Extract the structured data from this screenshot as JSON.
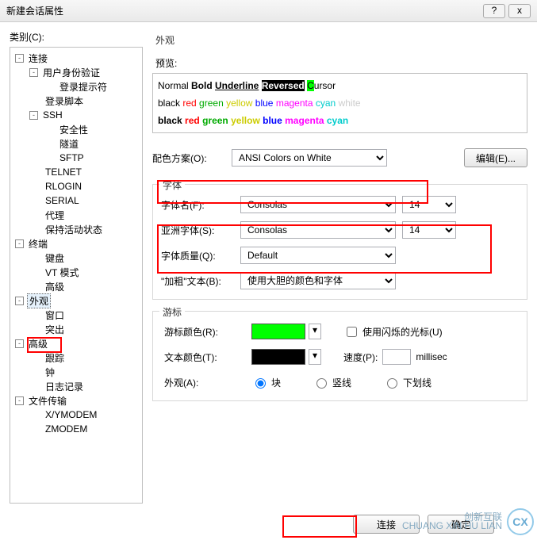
{
  "window": {
    "title": "新建会话属性",
    "help": "?",
    "close": "x"
  },
  "category": {
    "label": "类别(C):"
  },
  "tree": {
    "connection": "连接",
    "auth": "用户身份验证",
    "login_prompt": "登录提示符",
    "login_script": "登录脚本",
    "ssh": "SSH",
    "security": "安全性",
    "tunnel": "隧道",
    "sftp": "SFTP",
    "telnet": "TELNET",
    "rlogin": "RLOGIN",
    "serial": "SERIAL",
    "proxy": "代理",
    "keepalive": "保持活动状态",
    "terminal": "终端",
    "keyboard": "键盘",
    "vtmode": "VT 模式",
    "advanced_term": "高级",
    "appearance": "外观",
    "window": "窗口",
    "highlight": "突出",
    "advanced_appr": "高级",
    "trace": "跟踪",
    "bell": "钟",
    "logging": "日志记录",
    "filetransfer": "文件传输",
    "xymodem": "X/YMODEM",
    "zmodem": "ZMODEM"
  },
  "pane": {
    "title": "外观",
    "preview_label": "预览:",
    "preview": {
      "l1": {
        "normal": "Normal ",
        "bold": "Bold ",
        "underline": "Underline",
        "reversed": "Reversed",
        "cursor_c": "C",
        "cursor_rest": "ursor"
      },
      "l2": [
        "black",
        "red",
        "green",
        "yellow",
        "blue",
        "magenta",
        "cyan",
        "white"
      ],
      "l3": [
        "black",
        "red",
        "green",
        "yellow",
        "blue",
        "magenta",
        "cyan"
      ]
    },
    "scheme_label": "配色方案(O):",
    "scheme_value": "ANSI Colors on White",
    "edit_btn": "编辑(E)...",
    "font_legend": "字体",
    "font_name_label": "字体名(F):",
    "font_name_value": "Consolas",
    "font_size_value": "14",
    "asian_font_label": "亚洲字体(S):",
    "asian_font_value": "Consolas",
    "asian_size_value": "14",
    "font_quality_label": "字体质量(Q):",
    "font_quality_value": "Default",
    "bold_text_label": "\"加粗\"文本(B):",
    "bold_text_value": "使用大胆的颜色和字体",
    "cursor_legend": "游标",
    "cursor_color_label": "游标颜色(R):",
    "blink_checkbox": "使用闪烁的光标(U)",
    "text_color_label": "文本颜色(T):",
    "speed_label": "速度(P):",
    "speed_unit": "millisec",
    "appearance_radio_label": "外观(A):",
    "radio": {
      "block": "块",
      "vline": "竖线",
      "uline": "下划线"
    },
    "radio_selected": "block"
  },
  "footer": {
    "connect": "连接",
    "ok": "确定"
  },
  "watermark": {
    "logo": "CX",
    "line1": "创新互联",
    "line2": "CHUANG XIN HU LIAN"
  },
  "colors": {
    "black": "#000",
    "red": "#f00",
    "green": "#0a0",
    "yellow": "#cccc00",
    "blue": "#00f",
    "magenta": "#f0f",
    "cyan": "#0cc",
    "white": "#ccc"
  }
}
